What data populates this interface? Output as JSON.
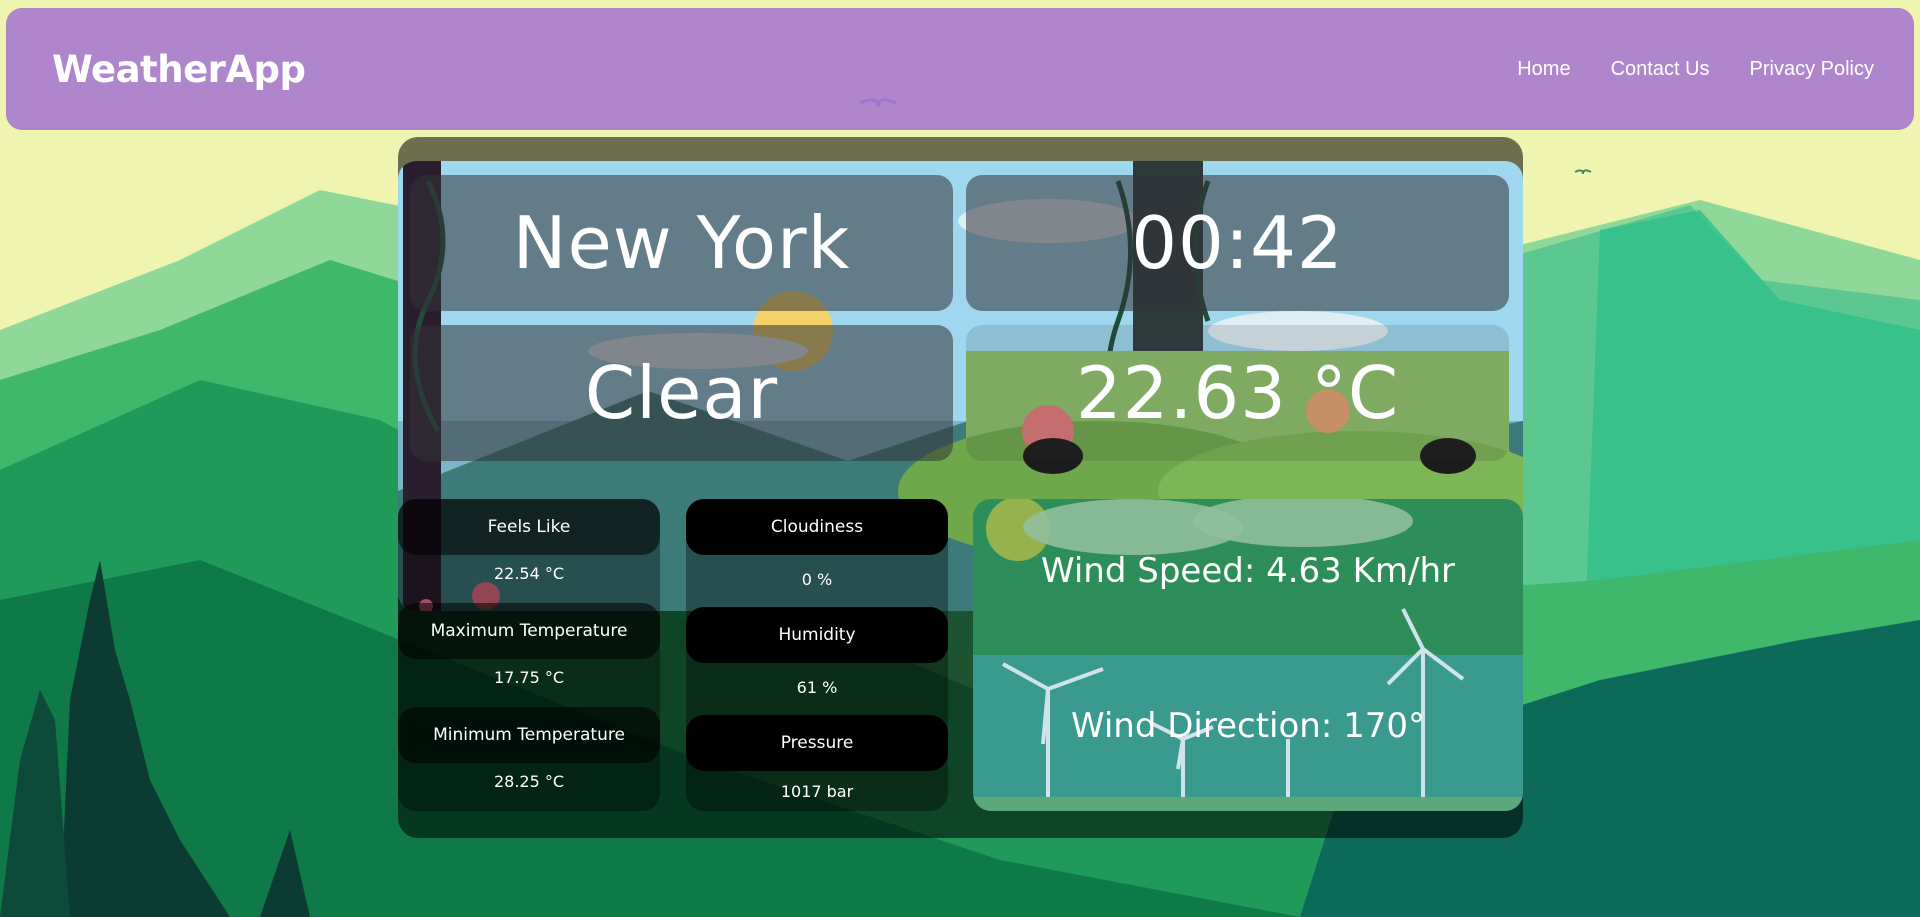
{
  "navbar": {
    "brand": "WeatherApp",
    "links": [
      "Home",
      "Contact Us",
      "Privacy Policy"
    ]
  },
  "weather": {
    "city": "New York",
    "time": "00:42",
    "condition": "Clear",
    "temperature": "22.63 °C"
  },
  "details": {
    "feels_like": {
      "label": "Feels Like",
      "value": "22.54 °C"
    },
    "max_temp": {
      "label": "Maximum Temperature",
      "value": "17.75 °C"
    },
    "min_temp": {
      "label": "Minimum Temperature",
      "value": "28.25 °C"
    },
    "cloudiness": {
      "label": "Cloudiness",
      "value": "0 %"
    },
    "humidity": {
      "label": "Humidity",
      "value": "61 %"
    },
    "pressure": {
      "label": "Pressure",
      "value": "1017 bar"
    }
  },
  "wind": {
    "speed": "Wind Speed: 4.63 Km/hr",
    "direction": "Wind Direction: 170°"
  },
  "colors": {
    "navbar": "#a676ce",
    "sky": "#f6f8b8",
    "mountains": "#2a9a5a"
  }
}
